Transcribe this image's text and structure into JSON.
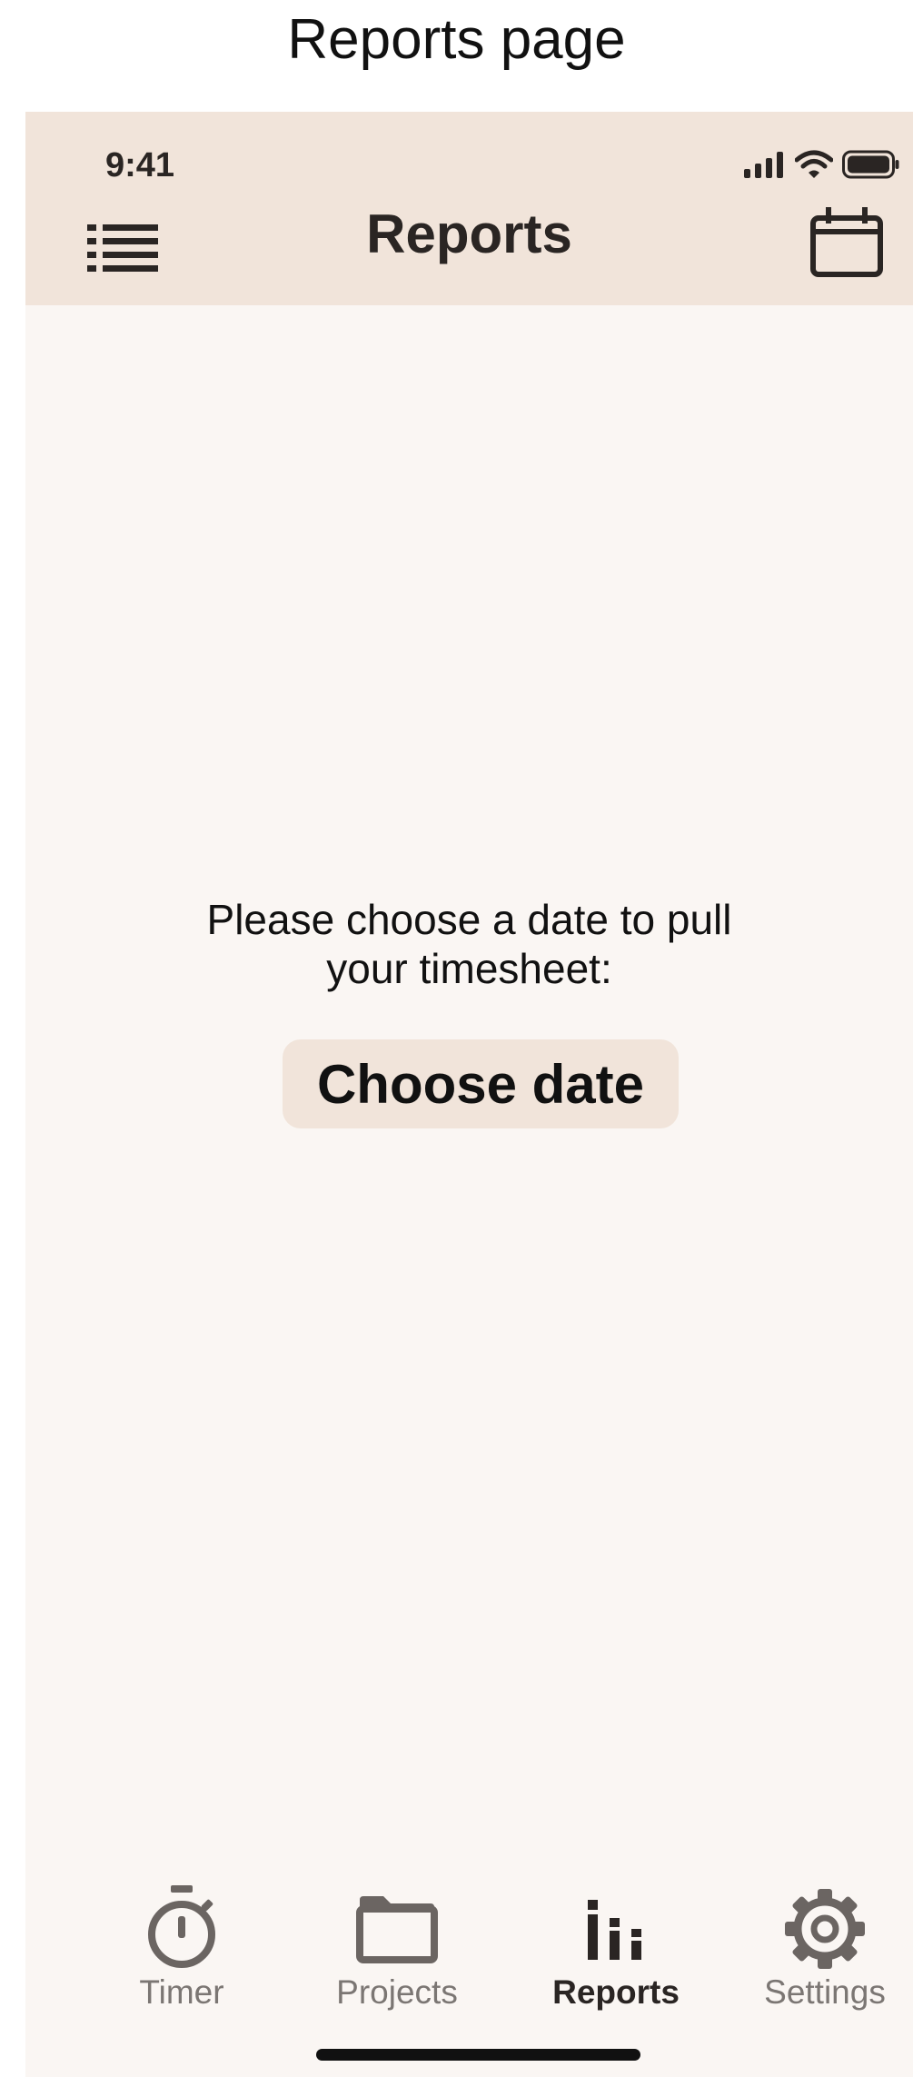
{
  "caption": "Reports page",
  "status_bar": {
    "time": "9:41"
  },
  "nav": {
    "title": "Reports",
    "left_icon": "list-icon",
    "right_icon": "calendar-icon"
  },
  "main": {
    "prompt_line1": "Please choose a date to pull",
    "prompt_line2": "your timesheet:",
    "choose_button": "Choose date"
  },
  "tabs": [
    {
      "label": "Timer",
      "icon": "stopwatch-icon",
      "active": false
    },
    {
      "label": "Projects",
      "icon": "folder-icon",
      "active": false
    },
    {
      "label": "Reports",
      "icon": "bar-chart-icon",
      "active": true
    },
    {
      "label": "Settings",
      "icon": "gear-icon",
      "active": false
    }
  ],
  "colors": {
    "header_bg": "#f1e4da",
    "page_bg": "#faf6f3",
    "text_dark": "#2a2523",
    "tab_inactive": "#7b7673",
    "button_bg": "#f1e4da"
  }
}
